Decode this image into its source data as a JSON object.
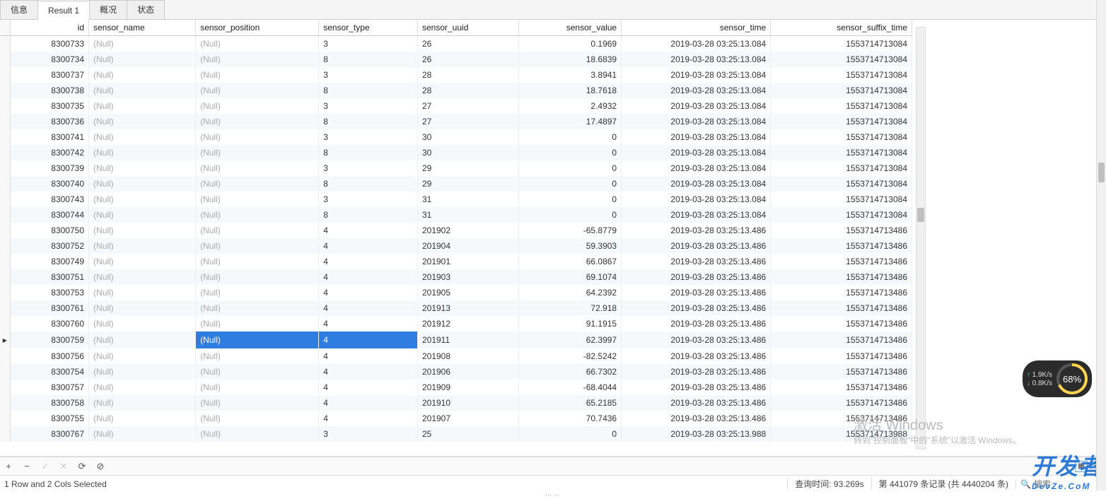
{
  "tabs": [
    "信息",
    "Result 1",
    "概况",
    "状态"
  ],
  "active_tab": 1,
  "columns": [
    "id",
    "sensor_name",
    "sensor_position",
    "sensor_type",
    "sensor_uuid",
    "sensor_value",
    "sensor_time",
    "sensor_suffix_time"
  ],
  "null_text": "(Null)",
  "selected_row": 20,
  "rows": [
    {
      "id": "8300733",
      "sensor_type": "3",
      "sensor_uuid": "26",
      "sensor_value": "0.1969",
      "sensor_time": "2019-03-28 03:25:13.084",
      "sensor_suffix_time": "1553714713084"
    },
    {
      "id": "8300734",
      "sensor_type": "8",
      "sensor_uuid": "26",
      "sensor_value": "18.6839",
      "sensor_time": "2019-03-28 03:25:13.084",
      "sensor_suffix_time": "1553714713084"
    },
    {
      "id": "8300737",
      "sensor_type": "3",
      "sensor_uuid": "28",
      "sensor_value": "3.8941",
      "sensor_time": "2019-03-28 03:25:13.084",
      "sensor_suffix_time": "1553714713084"
    },
    {
      "id": "8300738",
      "sensor_type": "8",
      "sensor_uuid": "28",
      "sensor_value": "18.7618",
      "sensor_time": "2019-03-28 03:25:13.084",
      "sensor_suffix_time": "1553714713084"
    },
    {
      "id": "8300735",
      "sensor_type": "3",
      "sensor_uuid": "27",
      "sensor_value": "2.4932",
      "sensor_time": "2019-03-28 03:25:13.084",
      "sensor_suffix_time": "1553714713084"
    },
    {
      "id": "8300736",
      "sensor_type": "8",
      "sensor_uuid": "27",
      "sensor_value": "17.4897",
      "sensor_time": "2019-03-28 03:25:13.084",
      "sensor_suffix_time": "1553714713084"
    },
    {
      "id": "8300741",
      "sensor_type": "3",
      "sensor_uuid": "30",
      "sensor_value": "0",
      "sensor_time": "2019-03-28 03:25:13.084",
      "sensor_suffix_time": "1553714713084"
    },
    {
      "id": "8300742",
      "sensor_type": "8",
      "sensor_uuid": "30",
      "sensor_value": "0",
      "sensor_time": "2019-03-28 03:25:13.084",
      "sensor_suffix_time": "1553714713084"
    },
    {
      "id": "8300739",
      "sensor_type": "3",
      "sensor_uuid": "29",
      "sensor_value": "0",
      "sensor_time": "2019-03-28 03:25:13.084",
      "sensor_suffix_time": "1553714713084"
    },
    {
      "id": "8300740",
      "sensor_type": "8",
      "sensor_uuid": "29",
      "sensor_value": "0",
      "sensor_time": "2019-03-28 03:25:13.084",
      "sensor_suffix_time": "1553714713084"
    },
    {
      "id": "8300743",
      "sensor_type": "3",
      "sensor_uuid": "31",
      "sensor_value": "0",
      "sensor_time": "2019-03-28 03:25:13.084",
      "sensor_suffix_time": "1553714713084"
    },
    {
      "id": "8300744",
      "sensor_type": "8",
      "sensor_uuid": "31",
      "sensor_value": "0",
      "sensor_time": "2019-03-28 03:25:13.084",
      "sensor_suffix_time": "1553714713084"
    },
    {
      "id": "8300750",
      "sensor_type": "4",
      "sensor_uuid": "201902",
      "sensor_value": "-65.8779",
      "sensor_time": "2019-03-28 03:25:13.486",
      "sensor_suffix_time": "1553714713486"
    },
    {
      "id": "8300752",
      "sensor_type": "4",
      "sensor_uuid": "201904",
      "sensor_value": "59.3903",
      "sensor_time": "2019-03-28 03:25:13.486",
      "sensor_suffix_time": "1553714713486"
    },
    {
      "id": "8300749",
      "sensor_type": "4",
      "sensor_uuid": "201901",
      "sensor_value": "66.0867",
      "sensor_time": "2019-03-28 03:25:13.486",
      "sensor_suffix_time": "1553714713486"
    },
    {
      "id": "8300751",
      "sensor_type": "4",
      "sensor_uuid": "201903",
      "sensor_value": "69.1074",
      "sensor_time": "2019-03-28 03:25:13.486",
      "sensor_suffix_time": "1553714713486"
    },
    {
      "id": "8300753",
      "sensor_type": "4",
      "sensor_uuid": "201905",
      "sensor_value": "64.2392",
      "sensor_time": "2019-03-28 03:25:13.486",
      "sensor_suffix_time": "1553714713486"
    },
    {
      "id": "8300761",
      "sensor_type": "4",
      "sensor_uuid": "201913",
      "sensor_value": "72.918",
      "sensor_time": "2019-03-28 03:25:13.486",
      "sensor_suffix_time": "1553714713486"
    },
    {
      "id": "8300760",
      "sensor_type": "4",
      "sensor_uuid": "201912",
      "sensor_value": "91.1915",
      "sensor_time": "2019-03-28 03:25:13.486",
      "sensor_suffix_time": "1553714713486"
    },
    {
      "id": "8300759",
      "sensor_type": "4",
      "sensor_uuid": "201911",
      "sensor_value": "62.3997",
      "sensor_time": "2019-03-28 03:25:13.486",
      "sensor_suffix_time": "1553714713486"
    },
    {
      "id": "8300756",
      "sensor_type": "4",
      "sensor_uuid": "201908",
      "sensor_value": "-82.5242",
      "sensor_time": "2019-03-28 03:25:13.486",
      "sensor_suffix_time": "1553714713486"
    },
    {
      "id": "8300754",
      "sensor_type": "4",
      "sensor_uuid": "201906",
      "sensor_value": "66.7302",
      "sensor_time": "2019-03-28 03:25:13.486",
      "sensor_suffix_time": "1553714713486"
    },
    {
      "id": "8300757",
      "sensor_type": "4",
      "sensor_uuid": "201909",
      "sensor_value": "-68.4044",
      "sensor_time": "2019-03-28 03:25:13.486",
      "sensor_suffix_time": "1553714713486"
    },
    {
      "id": "8300758",
      "sensor_type": "4",
      "sensor_uuid": "201910",
      "sensor_value": "65.2185",
      "sensor_time": "2019-03-28 03:25:13.486",
      "sensor_suffix_time": "1553714713486"
    },
    {
      "id": "8300755",
      "sensor_type": "4",
      "sensor_uuid": "201907",
      "sensor_value": "70.7436",
      "sensor_time": "2019-03-28 03:25:13.486",
      "sensor_suffix_time": "1553714713486"
    },
    {
      "id": "8300767",
      "sensor_type": "3",
      "sensor_uuid": "25",
      "sensor_value": "0",
      "sensor_time": "2019-03-28 03:25:13.988",
      "sensor_suffix_time": "1553714713988"
    }
  ],
  "toolbar": {
    "add": "+",
    "remove": "−",
    "accept": "✓",
    "cancel": "✕",
    "refresh": "⟳",
    "stop": "⊘"
  },
  "status": {
    "selection": "1 Row and 2 Cols Selected",
    "query_time": "查询时间: 93.269s",
    "record": "第 441079 条记录 (共 4440204 条)",
    "search_placeholder": "搜索"
  },
  "watermark": {
    "title": "激活 Windows",
    "sub": "转到\"控制面板\"中的\"系统\"以激活 Windows。"
  },
  "logo_text": "开发者",
  "logo_sub": "DevZe.CoM",
  "gauge": {
    "up": "1.9K/s",
    "down": "0.8K/s",
    "pct": "68%"
  }
}
